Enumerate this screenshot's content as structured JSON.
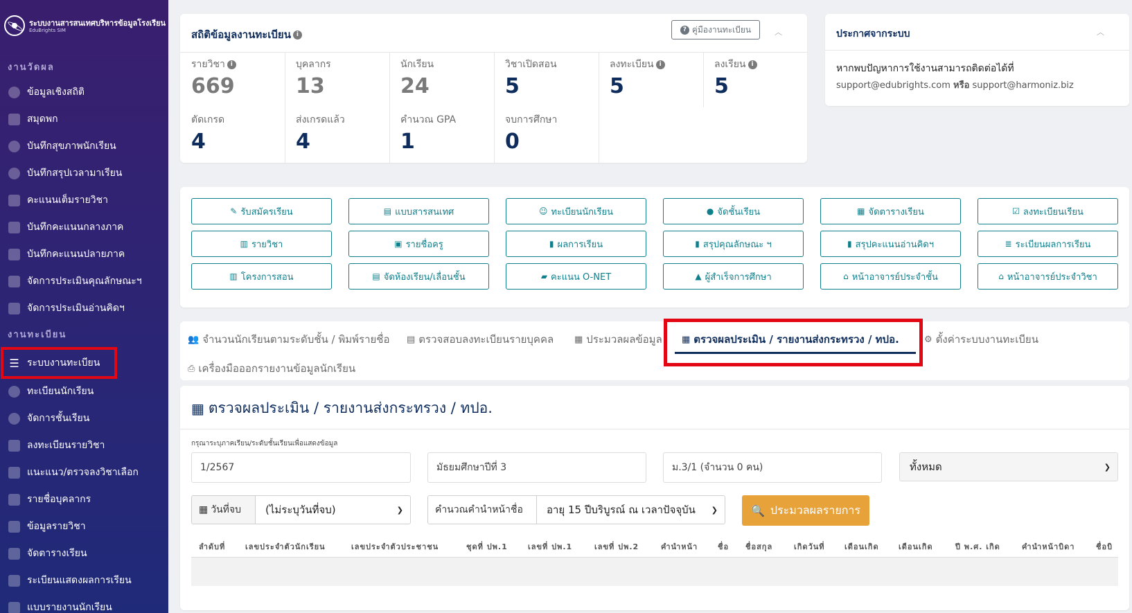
{
  "brand": {
    "name": "ระบบงานสารสนเทศบริหารข้อมูลโรงเรียน",
    "sub": "EduBrights SIM"
  },
  "sidebar": {
    "section1": "งานวัดผล",
    "items1": [
      "ข้อมูลเชิงสถิติ",
      "สมุดพก",
      "บันทึกสุขภาพนักเรียน",
      "บันทึกสรุปเวลามาเรียน",
      "คะแนนเต็มรายวิชา",
      "บันทึกคะแนนกลางภาค",
      "บันทึกคะแนนปลายภาค",
      "จัดการประเมินคุณลักษณะฯ",
      "จัดการประเมินอ่านคิดฯ"
    ],
    "section2": "งานทะเบียน",
    "items2": [
      "ระบบงานทะเบียน",
      "ทะเบียนนักเรียน",
      "จัดการชั้นเรียน",
      "ลงทะเบียนรายวิชา",
      "แนะแนว/ตรวจลงวิชาเลือก",
      "รายชื่อบุคลากร",
      "ข้อมูลรายวิชา",
      "จัดตารางเรียน",
      "ระเบียนแสดงผลการเรียน",
      "แบบรายงานนักเรียน"
    ]
  },
  "stats": {
    "title": "สถิติข้อมูลงานทะเบียน",
    "guide": "คู่มืองานทะเบียน",
    "row1": [
      {
        "label": "รายวิชา",
        "value": "669"
      },
      {
        "label": "บุคลากร",
        "value": "13"
      },
      {
        "label": "นักเรียน",
        "value": "24"
      },
      {
        "label": "วิชาเปิดสอน",
        "value": "5"
      },
      {
        "label": "ลงทะเบียน",
        "value": "5"
      },
      {
        "label": "ลงเรียน",
        "value": "5"
      }
    ],
    "row2": [
      {
        "label": "ตัดเกรด",
        "value": "4"
      },
      {
        "label": "ส่งเกรดแล้ว",
        "value": "4"
      },
      {
        "label": "คำนวณ GPA",
        "value": "1"
      },
      {
        "label": "จบการศึกษา",
        "value": "0"
      }
    ]
  },
  "announce": {
    "title": "ประกาศจากระบบ",
    "line1": "หากพบปัญหาการใช้งานสามารถติดต่อได้ที่",
    "email1": "support@edubrights.com",
    "or": "หรือ",
    "email2": "support@harmoniz.biz"
  },
  "quick": [
    [
      "รับสมัครเรียน",
      "แบบสารสนเทศ",
      "ทะเบียนนักเรียน",
      "จัดชั้นเรียน",
      "จัดตารางเรียน",
      "ลงทะเบียนเรียน"
    ],
    [
      "รายวิชา",
      "รายชื่อครู",
      "ผลการเรียน",
      "สรุปคุณลักษณะ ฯ",
      "สรุปคะแนนอ่านคิดฯ",
      "ระเบียนผลการเรียน"
    ],
    [
      "โครงการสอน",
      "จัดห้องเรียน/เลื่อนชั้น",
      "คะแนน O-NET",
      "ผู้สำเร็จการศึกษา",
      "หน้าอาจารย์ประจำชั้น",
      "หน้าอาจารย์ประจำวิชา"
    ]
  ],
  "tabs": [
    "จำนวนนักเรียนตามระดับชั้น / พิมพ์รายชื่อ",
    "ตรวจสอบลงทะเบียนรายบุคคล",
    "ประมวลผลข้อมูล",
    "ตรวจผลประเมิน / รายงานส่งกระทรวง / ทปอ.",
    "ตั้งค่าระบบงานทะเบียน",
    "เครื่องมือออกรายงานข้อมูลนักเรียน"
  ],
  "main": {
    "title": "ตรวจผลประเมิน / รายงานส่งกระทรวง / ทปอ.",
    "hint": "กรุณาระบุภาคเรียน/ระดับชั้นเรียนเพื่อแสดงข้อมูล",
    "term": "1/2567",
    "level": "มัธยมศึกษาปีที่ 3",
    "room": "ม.3/1 (จำนวน 0 คน)",
    "filter": "ทั้งหมด",
    "end_label": "วันที่จบ",
    "end_value": "(ไม่ระบุวันที่จบ)",
    "prefix_label": "คำนวณคำนำหน้าชื่อ",
    "prefix_value": "อายุ 15 ปีบริบูรณ์ ณ เวลาปัจจุบัน",
    "process": "ประมวลผลรายการ",
    "columns": [
      "ลำดับที่",
      "เลขประจำตัวนักเรียน",
      "เลขประจำตัวประชาชน",
      "ชุดที่ ปพ.1",
      "เลขที่ ปพ.1",
      "เลขที่ ปพ.2",
      "คำนำหน้า",
      "ชื่อ",
      "ชื่อสกุล",
      "เกิดวันที่",
      "เดือนเกิด",
      "เดือนเกิด",
      "ปี พ.ศ. เกิด",
      "คำนำหน้าบิดา",
      "ชื่อบิ"
    ]
  }
}
